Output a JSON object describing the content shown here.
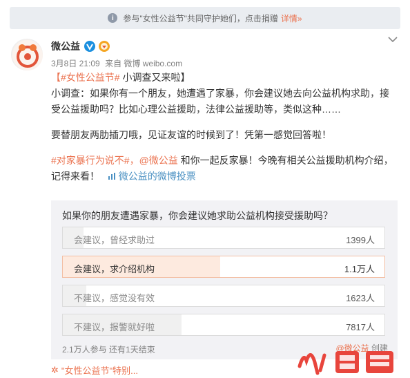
{
  "notice": {
    "icon": "info-icon",
    "text": "参与\"女性公益节\"共同守护她们，点击捐赠",
    "link": "详情»"
  },
  "post": {
    "author": "微公益",
    "verified_badge": "V",
    "time": "3月8日 21:09",
    "source": "来自 微博 weibo.com",
    "title_hashtag": "【#女性公益节#",
    "title_rest": " 小调查又来啦】",
    "para1": "小调查：如果你有一个朋友，她遭遇了家暴，你会建议她去向公益机构求助，接受公益援助吗？比如心理公益援助，法律公益援助等，类似这种……",
    "para2": "要替朋友两肋插刀哦，见证友谊的时候到了！凭第一感觉回答啦！",
    "hashtag2": "#对家暴行为说不#",
    "mention": "，@微公益",
    "para3_rest": " 和你一起反家暴！今晚有相关公益援助机构介绍，记得来看！",
    "vote_link": "微公益的微博投票"
  },
  "poll": {
    "question": "如果你的朋友遭遇家暴，你会建议她求助公益机构接受援助吗？",
    "options": [
      {
        "label": "会建议，曾经求助过",
        "count": "1399人",
        "share": 0.064
      },
      {
        "label": "会建议，求介绍机构",
        "count": "1.1万人",
        "share": 0.49
      },
      {
        "label": "不建议，感觉没有效",
        "count": "1623人",
        "share": 0.074
      },
      {
        "label": "不建议，报警就好啦",
        "count": "7817人",
        "share": 0.37
      }
    ],
    "selected_index": 1,
    "footer": "2.1万人参与 还有1天结束",
    "creator_mention": "@微公益",
    "creator_suffix": " 创建"
  },
  "bottom": {
    "tag": "\"女性公益节\"特别..."
  },
  "watermark": {
    "text": "火鲤鱼"
  },
  "colors": {
    "accent": "#eb7350",
    "poll_bg": "#f2f2f5",
    "selected_fill": "#fdeadf"
  }
}
